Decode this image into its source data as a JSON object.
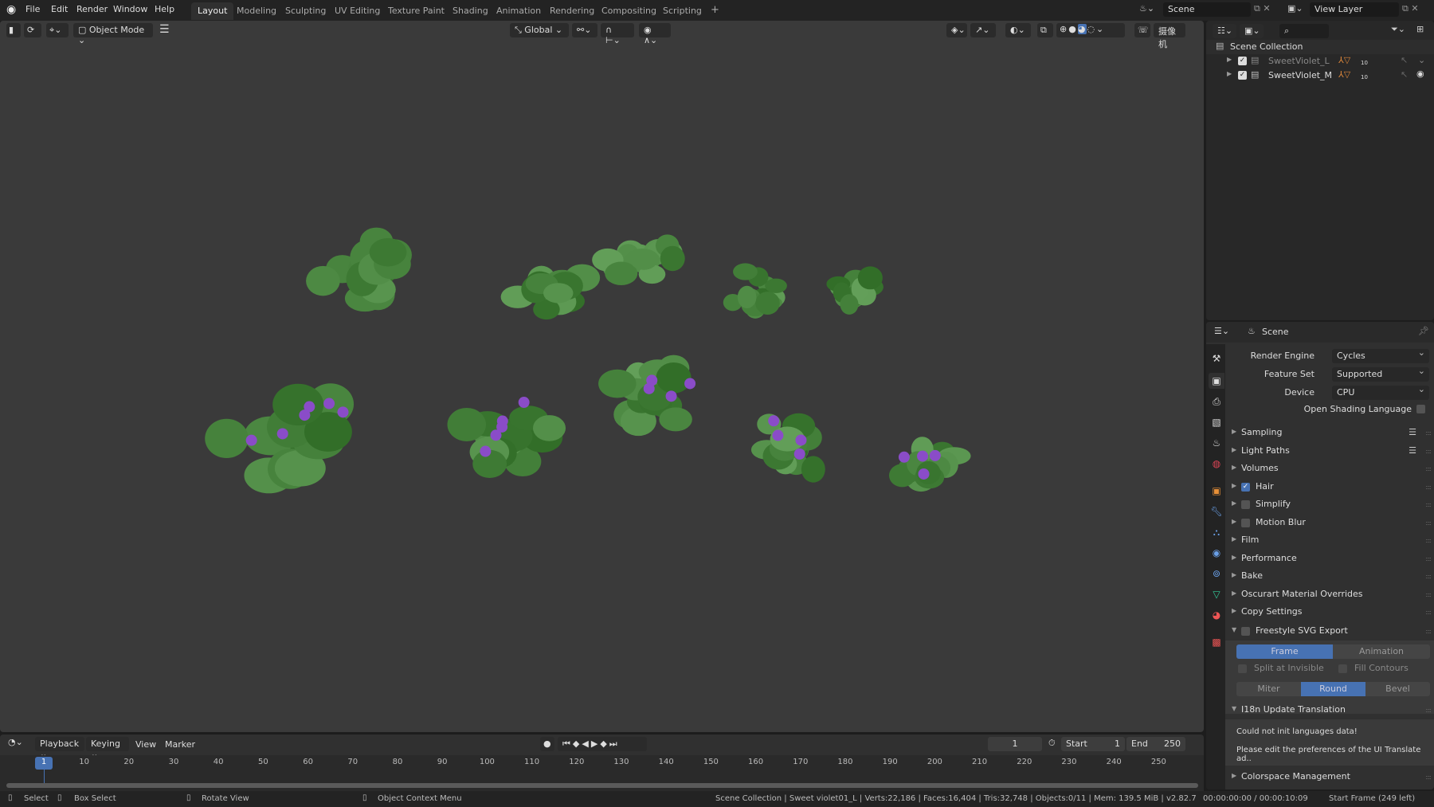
{
  "menubar": {
    "items": [
      "File",
      "Edit",
      "Render",
      "Window",
      "Help"
    ],
    "workspaces": [
      "Layout",
      "Modeling",
      "Sculpting",
      "UV Editing",
      "Texture Paint",
      "Shading",
      "Animation",
      "Rendering",
      "Compositing",
      "Scripting"
    ],
    "active_workspace": "Layout",
    "add": "+",
    "scene": "Scene",
    "view_layer": "View Layer"
  },
  "viewport_header": {
    "mode": "Object Mode",
    "orientation": "Global",
    "camera_label": "摄像机"
  },
  "outliner": {
    "root": "Scene Collection",
    "items": [
      {
        "name": "SweetViolet_L",
        "count": "10",
        "visible": false
      },
      {
        "name": "SweetViolet_M",
        "count": "10",
        "visible": true
      }
    ]
  },
  "properties": {
    "context": "Scene",
    "render_engine_label": "Render Engine",
    "render_engine": "Cycles",
    "feature_set_label": "Feature Set",
    "feature_set": "Supported",
    "device_label": "Device",
    "device": "CPU",
    "osl_label": "Open Shading Language",
    "panels": [
      {
        "label": "Sampling",
        "checkbox": null
      },
      {
        "label": "Light Paths",
        "checkbox": null
      },
      {
        "label": "Volumes",
        "checkbox": null
      },
      {
        "label": "Hair",
        "checkbox": true
      },
      {
        "label": "Simplify",
        "checkbox": false
      },
      {
        "label": "Motion Blur",
        "checkbox": false
      },
      {
        "label": "Film",
        "checkbox": null
      },
      {
        "label": "Performance",
        "checkbox": null
      },
      {
        "label": "Bake",
        "checkbox": null
      },
      {
        "label": "Oscurart Material Overrides",
        "checkbox": null
      },
      {
        "label": "Copy Settings",
        "checkbox": null
      }
    ],
    "freestyle": {
      "label": "Freestyle SVG Export",
      "frame": "Frame",
      "animation": "Animation",
      "split": "Split at Invisible",
      "fill": "Fill Contours",
      "miter": "Miter",
      "round": "Round",
      "bevel": "Bevel"
    },
    "i18n": {
      "label": "I18n Update Translation",
      "msg1": "Could not init languages data!",
      "msg2": "Please edit the preferences of the UI Translate ad.."
    },
    "colorspace": "Colorspace Management"
  },
  "timeline": {
    "menus": [
      "Playback",
      "Keying",
      "View",
      "Marker"
    ],
    "current_frame": "1",
    "start_label": "Start",
    "start": "1",
    "end_label": "End",
    "end": "250",
    "ticks": [
      10,
      20,
      30,
      40,
      50,
      60,
      70,
      80,
      90,
      100,
      110,
      120,
      130,
      140,
      150,
      160,
      170,
      180,
      190,
      200,
      210,
      220,
      230,
      240,
      250
    ]
  },
  "statusbar": {
    "select": "Select",
    "box_select": "Box Select",
    "rotate": "Rotate View",
    "context_menu": "Object Context Menu",
    "stats": "Scene Collection | Sweet violet01_L | Verts:22,186 | Faces:16,404 | Tris:32,748 | Objects:0/11 | Mem: 139.5 MiB | v2.82.7",
    "time": "00:00:00:00 / 00:00:10:09",
    "start_frame": "Start Frame (249 left)"
  },
  "colors": {
    "accent": "#4772b3",
    "background": "#3a3a3a",
    "leaf": "#4d6b35",
    "flower": "#8a4cc8"
  }
}
